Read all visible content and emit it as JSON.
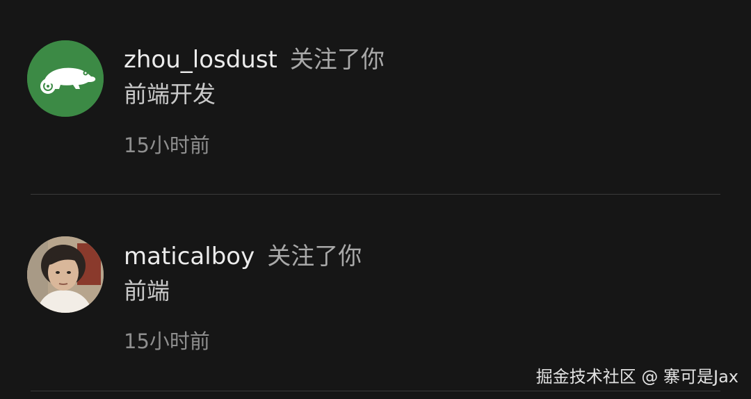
{
  "followers": [
    {
      "username": "zhou_losdust",
      "action": "关注了你",
      "bio": "前端开发",
      "time": "15小时前",
      "avatar_icon": "chameleon-logo-icon",
      "avatar_bg": "#3c8a45"
    },
    {
      "username": "maticalboy",
      "action": "关注了你",
      "bio": "前端",
      "time": "15小时前",
      "avatar_icon": "person-photo-icon",
      "avatar_bg": "#c9b8a0"
    }
  ],
  "watermark": "掘金技术社区 @ 寨可是Jax",
  "colors": {
    "background": "#161616",
    "divider": "#3a3a3a",
    "secondary_text": "#a9a9a9"
  }
}
